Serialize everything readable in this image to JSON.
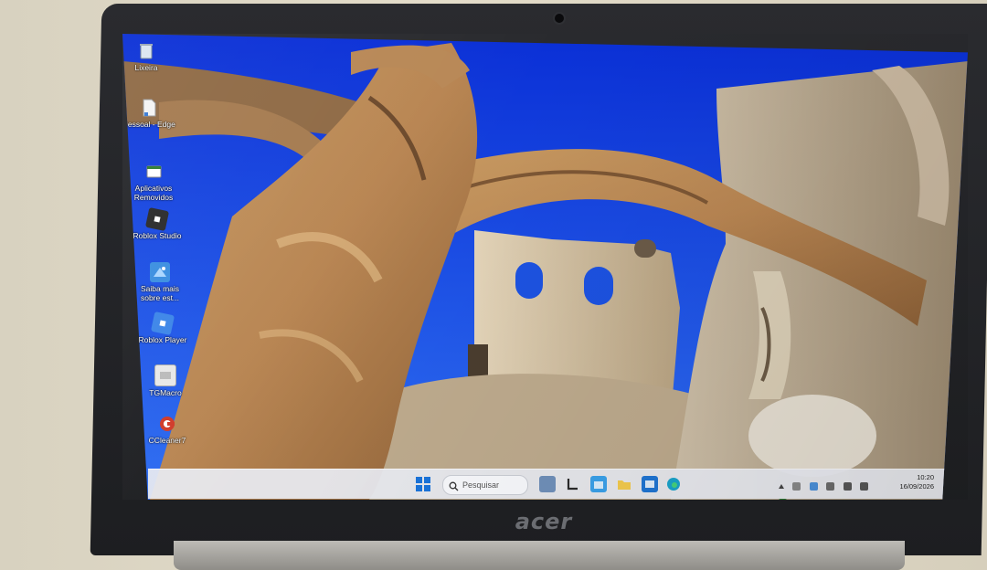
{
  "device": {
    "brand": "acer"
  },
  "desktop": {
    "icons": [
      {
        "id": "recycle-bin",
        "label": "Lixeira",
        "icon": "recycle-bin-icon",
        "color": "#d9e6f2"
      },
      {
        "id": "pessoal-edge",
        "label": "Pessoal - Edge",
        "icon": "file-shortcut-icon",
        "color": "#f0f0f0"
      },
      {
        "id": "aplicativos-removidos",
        "label": "Aplicativos Removidos",
        "icon": "html-doc-icon",
        "color": "#ffffff"
      },
      {
        "id": "roblox-studio",
        "label": "Roblox Studio",
        "icon": "roblox-studio-icon",
        "color": "#2b2b2b"
      },
      {
        "id": "saiba-mais",
        "label": "Saiba mais sobre est...",
        "icon": "learn-more-icon",
        "color": "#3b8fe0"
      },
      {
        "id": "roblox-player",
        "label": "Roblox Player",
        "icon": "roblox-player-icon",
        "color": "#3d86e8"
      },
      {
        "id": "tgmacro",
        "label": "TGMacro",
        "icon": "tgmacro-icon",
        "color": "#e8e8e8"
      },
      {
        "id": "ccleaner",
        "label": "CCleaner7",
        "icon": "ccleaner-icon",
        "color": "#d03a2a"
      }
    ]
  },
  "taskbar": {
    "search_placeholder": "Pesquisar",
    "apps": [
      {
        "id": "widgets",
        "icon": "widgets-icon",
        "color": "#6f8fb8"
      },
      {
        "id": "task-view",
        "icon": "task-view-icon",
        "color": "#2a2a2a"
      },
      {
        "id": "store",
        "icon": "store-icon",
        "color": "#3aa0e8"
      },
      {
        "id": "explorer",
        "icon": "folder-icon",
        "color": "#f2c94c"
      },
      {
        "id": "outlook",
        "icon": "mail-icon",
        "color": "#1f74d1"
      },
      {
        "id": "edge",
        "icon": "edge-icon",
        "color": "#1aa2c9"
      }
    ],
    "clock_time": "10:20",
    "clock_date": "16/09/2026"
  }
}
